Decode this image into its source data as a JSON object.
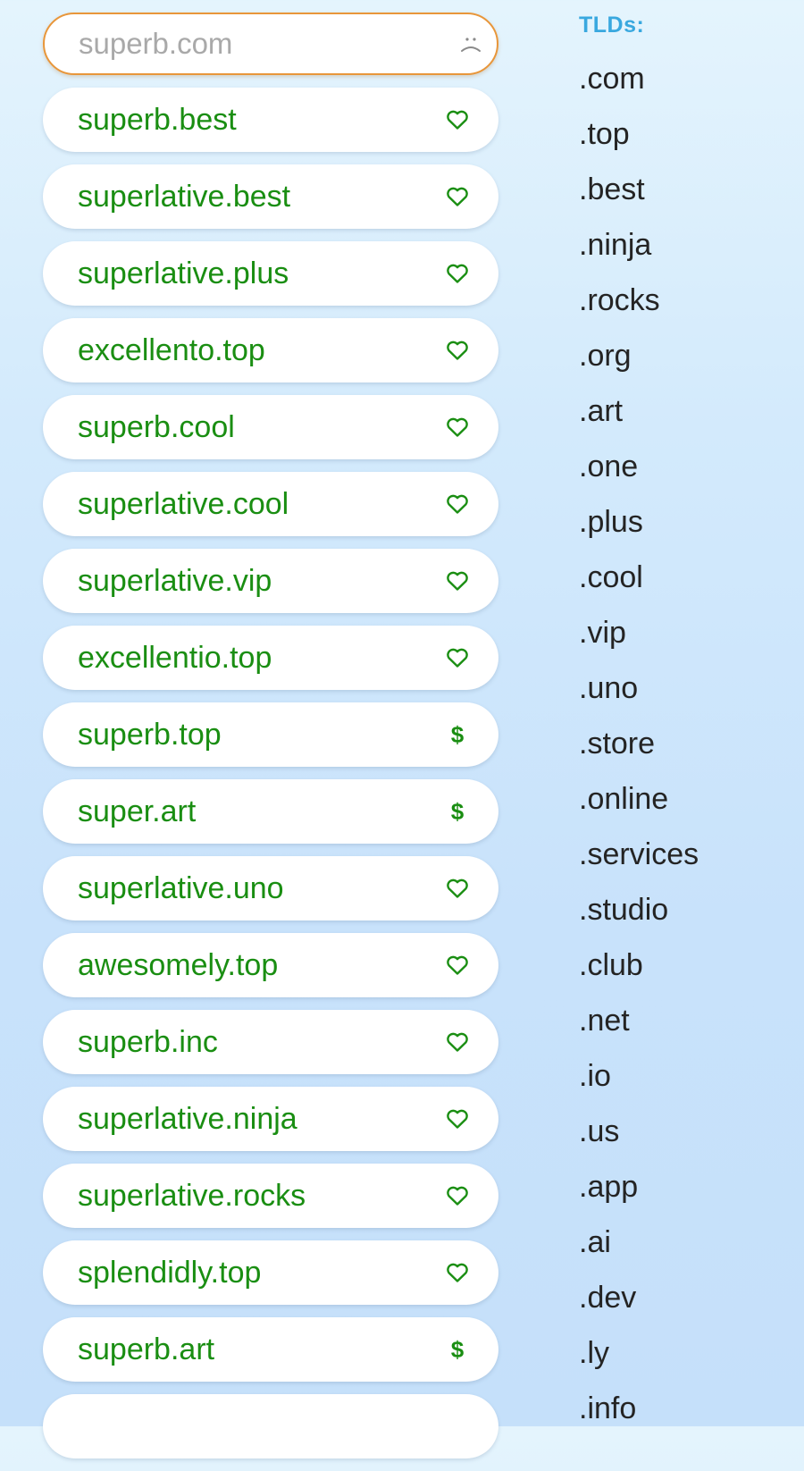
{
  "search": {
    "placeholder": "superb.com",
    "value": "",
    "status_icon": "sad-face-icon"
  },
  "results": [
    {
      "domain": "superb.best",
      "status": "available",
      "icon": "heart-icon"
    },
    {
      "domain": "superlative.best",
      "status": "available",
      "icon": "heart-icon"
    },
    {
      "domain": "superlative.plus",
      "status": "available",
      "icon": "heart-icon"
    },
    {
      "domain": "excellento.top",
      "status": "available",
      "icon": "heart-icon"
    },
    {
      "domain": "superb.cool",
      "status": "available",
      "icon": "heart-icon"
    },
    {
      "domain": "superlative.cool",
      "status": "available",
      "icon": "heart-icon"
    },
    {
      "domain": "superlative.vip",
      "status": "available",
      "icon": "heart-icon"
    },
    {
      "domain": "excellentio.top",
      "status": "available",
      "icon": "heart-icon"
    },
    {
      "domain": "superb.top",
      "status": "premium",
      "icon": "dollar-icon",
      "icon_text": "$"
    },
    {
      "domain": "super.art",
      "status": "premium",
      "icon": "dollar-icon",
      "icon_text": "$"
    },
    {
      "domain": "superlative.uno",
      "status": "available",
      "icon": "heart-icon"
    },
    {
      "domain": "awesomely.top",
      "status": "available",
      "icon": "heart-icon"
    },
    {
      "domain": "superb.inc",
      "status": "available",
      "icon": "heart-icon"
    },
    {
      "domain": "superlative.ninja",
      "status": "available",
      "icon": "heart-icon"
    },
    {
      "domain": "superlative.rocks",
      "status": "available",
      "icon": "heart-icon"
    },
    {
      "domain": "splendidly.top",
      "status": "available",
      "icon": "heart-icon"
    },
    {
      "domain": "superb.art",
      "status": "premium",
      "icon": "dollar-icon",
      "icon_text": "$"
    },
    {
      "domain": "",
      "status": "",
      "icon": ""
    }
  ],
  "tlds": {
    "heading": "TLDs:",
    "items": [
      ".com",
      ".top",
      ".best",
      ".ninja",
      ".rocks",
      ".org",
      ".art",
      ".one",
      ".plus",
      ".cool",
      ".vip",
      ".uno",
      ".store",
      ".online",
      ".services",
      ".studio",
      ".club",
      ".net",
      ".io",
      ".us",
      ".app",
      ".ai",
      ".dev",
      ".ly",
      ".info"
    ]
  },
  "colors": {
    "available_green": "#1a8e12",
    "search_border_orange": "#e8963a",
    "tld_heading_blue": "#39a8df",
    "background_top": "#e4f4fd",
    "background_bottom": "#c5e0fa"
  }
}
